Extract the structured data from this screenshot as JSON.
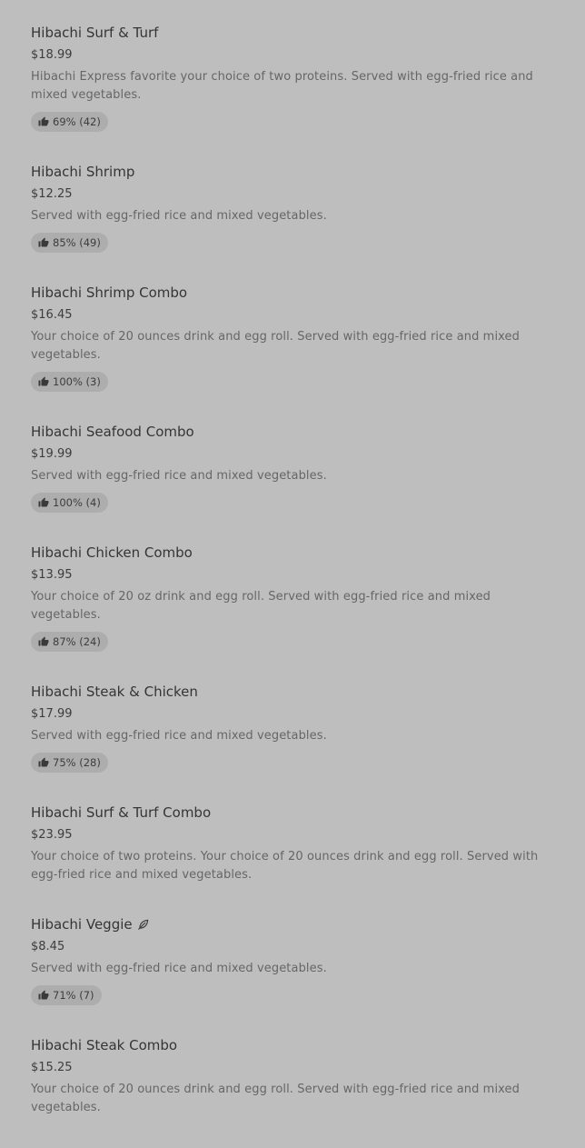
{
  "menu_items": [
    {
      "name": "Hibachi Surf & Turf",
      "price": "$18.99",
      "description": "Hibachi Express favorite your choice of two proteins. Served with egg-fried rice and mixed vegetables.",
      "rating": "69% (42)"
    },
    {
      "name": "Hibachi Shrimp",
      "price": "$12.25",
      "description": "Served with egg-fried rice and mixed vegetables.",
      "rating": "85% (49)"
    },
    {
      "name": "Hibachi Shrimp Combo",
      "price": "$16.45",
      "description": "Your choice of 20 ounces drink and egg roll. Served with egg-fried rice and mixed vegetables.",
      "rating": "100% (3)"
    },
    {
      "name": "Hibachi Seafood Combo",
      "price": "$19.99",
      "description": "Served with egg-fried rice and mixed vegetables.",
      "rating": "100% (4)"
    },
    {
      "name": "Hibachi Chicken Combo",
      "price": "$13.95",
      "description": "Your choice of 20 oz drink and egg roll. Served with egg-fried rice and mixed vegetables.",
      "rating": "87% (24)"
    },
    {
      "name": "Hibachi Steak & Chicken",
      "price": "$17.99",
      "description": "Served with egg-fried rice and mixed vegetables.",
      "rating": "75% (28)"
    },
    {
      "name": "Hibachi Surf & Turf Combo",
      "price": "$23.95",
      "description": "Your choice of two proteins. Your choice of 20 ounces drink and egg roll. Served with egg-fried rice and mixed vegetables.",
      "rating": ""
    },
    {
      "name": "Hibachi Veggie",
      "price": "$8.45",
      "description": "Served with egg-fried rice and mixed vegetables.",
      "rating": "71% (7)",
      "icon": "leaf-icon"
    },
    {
      "name": "Hibachi Steak Combo",
      "price": "$15.25",
      "description": "Your choice of 20 ounces drink and egg roll. Served with egg-fried rice and mixed vegetables.",
      "rating": ""
    }
  ],
  "icons": {
    "thumb": "thumbs-up-icon",
    "leaf": "leaf-icon"
  },
  "colors": {
    "background": "#bebebe",
    "badge": "#adadad"
  }
}
